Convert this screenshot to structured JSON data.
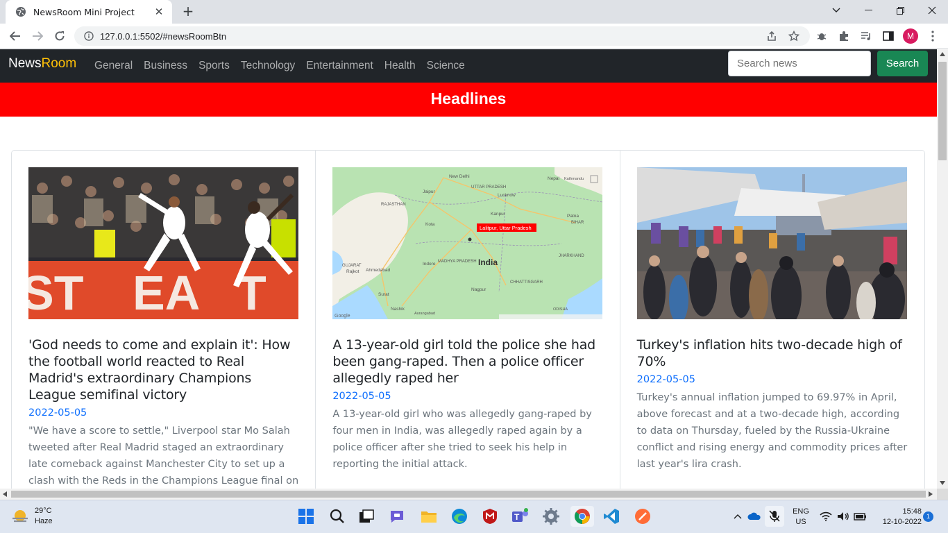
{
  "browser": {
    "tab_title": "NewsRoom Mini Project",
    "url": "127.0.0.1:5502/#newsRoomBtn",
    "profile_initial": "M"
  },
  "navbar": {
    "brand_news": "News",
    "brand_room": "Room",
    "links": [
      "General",
      "Business",
      "Sports",
      "Technology",
      "Entertainment",
      "Health",
      "Science"
    ],
    "search_placeholder": "Search news",
    "search_button": "Search"
  },
  "headline_bar": "Headlines",
  "articles": [
    {
      "title": "'God needs to come and explain it': How the football world reacted to Real Madrid's extraordinary Champions League semifinal victory",
      "date": "2022-05-05",
      "description": "\"We have a score to settle,\" Liverpool star Mo Salah tweeted after Real Madrid staged an extraordinary late comeback against Manchester City to set up a clash with the Reds in the Champions League final on May"
    },
    {
      "title": "A 13-year-old girl told the police she had been gang-raped. Then a police officer allegedly raped her",
      "date": "2022-05-05",
      "description": "A 13-year-old girl who was allegedly gang-raped by four men in India, was allegedly raped again by a police officer after she tried to seek his help in reporting the initial attack.",
      "map_labels": {
        "country": "India",
        "marker": "Lalitpur, Uttar Pradesh",
        "places": [
          "New Delhi",
          "Jaipur",
          "RAJASTHAN",
          "UTTAR PRADESH",
          "Lucknow",
          "Kanpur",
          "Kota",
          "Nepal",
          "Kathmandu",
          "Patna",
          "BIHAR",
          "GUJARAT",
          "Rajkot",
          "Ahmedabad",
          "Indore",
          "MADHYA PRADESH",
          "JHARKHAND",
          "Surat",
          "Nagpur",
          "CHHATTISGARH",
          "Nashik",
          "Aurangabad",
          "ODISHA",
          "Google"
        ]
      }
    },
    {
      "title": "Turkey's inflation hits two-decade high of 70%",
      "date": "2022-05-05",
      "description": "Turkey's annual inflation jumped to 69.97% in April, above forecast and at a two-decade high, according to data on Thursday, fueled by the Russia-Ukraine conflict and rising energy and commodity prices after last year's lira crash."
    }
  ],
  "taskbar": {
    "temperature": "29°C",
    "weather": "Haze",
    "language": "ENG",
    "region": "US",
    "time": "15:48",
    "date": "12-10-2022",
    "notifications": "1"
  }
}
